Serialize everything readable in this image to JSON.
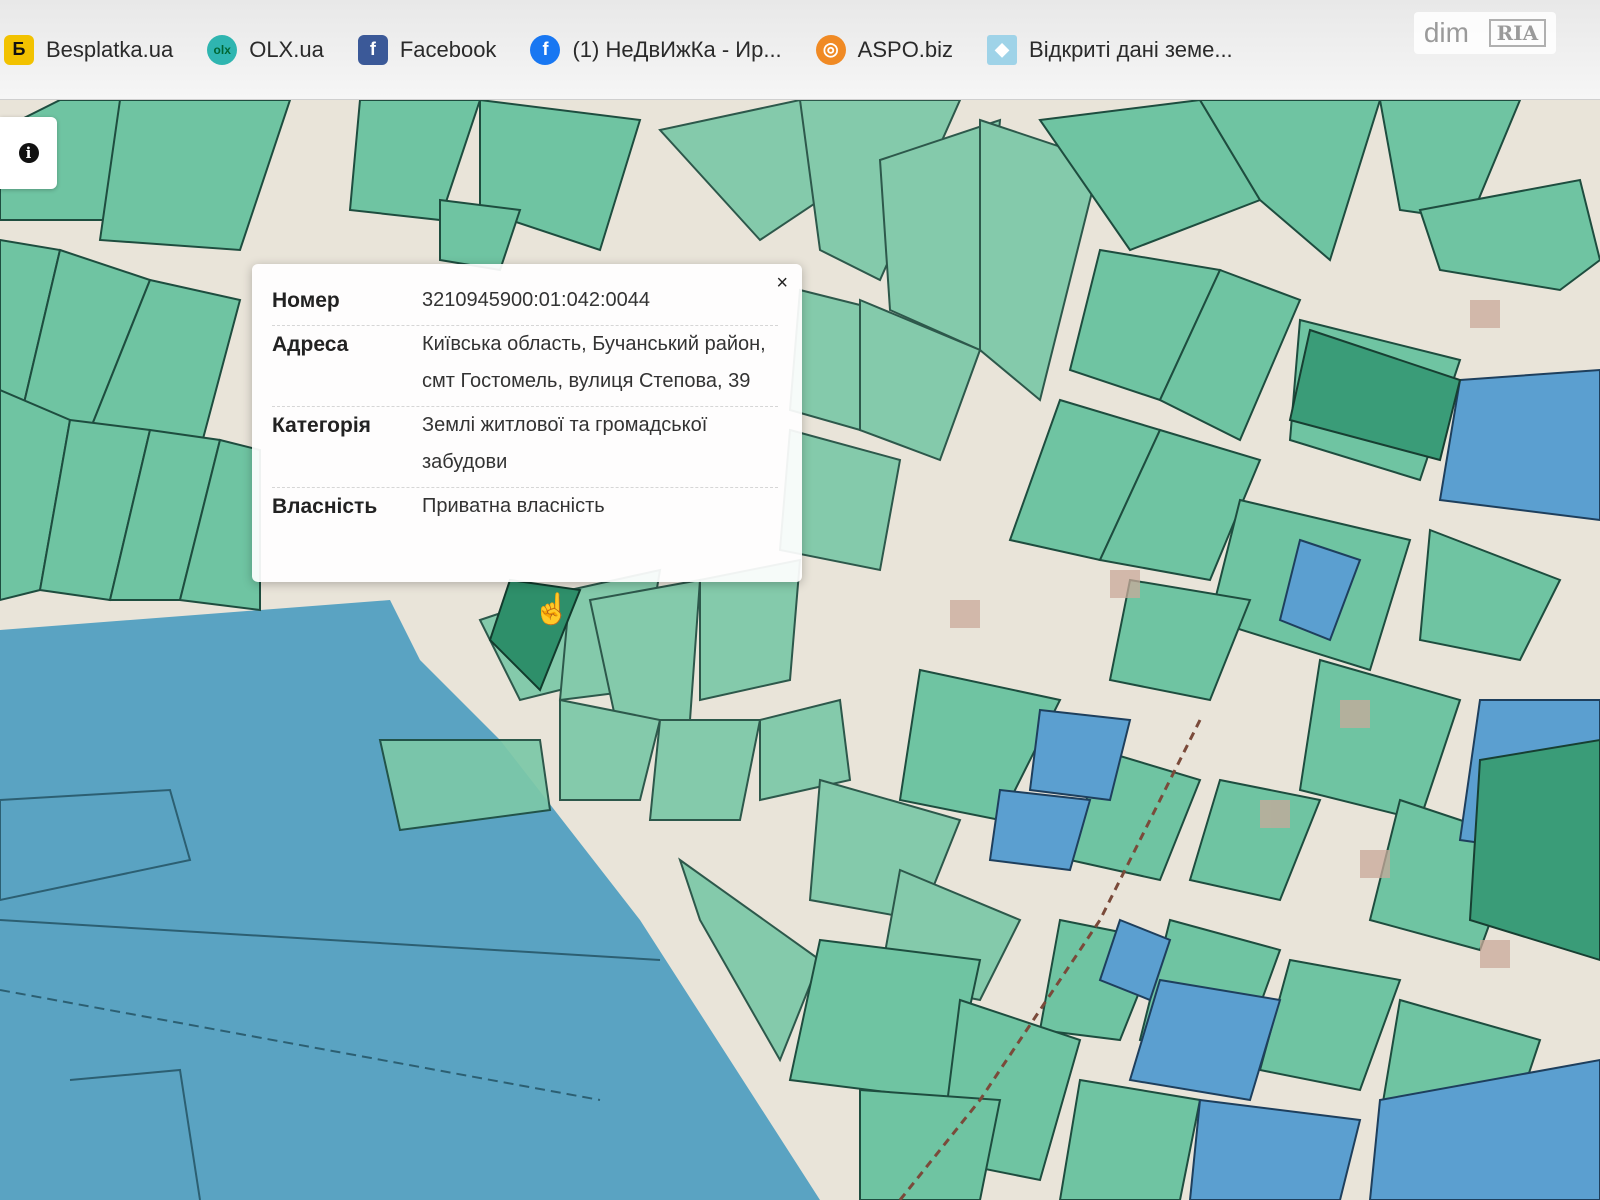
{
  "bookmarks": [
    {
      "label": "Besplatka.ua",
      "icon": "besplatka-icon",
      "glyph": "Б"
    },
    {
      "label": "OLX.ua",
      "icon": "olx-icon",
      "glyph": "olx"
    },
    {
      "label": "Facebook",
      "icon": "facebook-icon",
      "glyph": "f"
    },
    {
      "label": "(1) НеДвИжКа - Ир...",
      "icon": "facebook-round-icon",
      "glyph": "f"
    },
    {
      "label": "ASPO.biz",
      "icon": "aspo-icon",
      "glyph": "◎"
    },
    {
      "label": "Відкриті дані земе...",
      "icon": "open-data-icon",
      "glyph": "◆"
    }
  ],
  "info_button": {
    "glyph": "i",
    "icon": "info-icon"
  },
  "popup": {
    "close": "×",
    "rows": [
      {
        "label": "Номер",
        "value": "3210945900:01:042:0044"
      },
      {
        "label": "Адреса",
        "value": "Київська область, Бучанський район, смт Гостомель, вулиця Степова, 39"
      },
      {
        "label": "Категорія",
        "value": "Землі житлової та громадської забудови"
      },
      {
        "label": "Власність",
        "value": "Приватна власність"
      }
    ]
  },
  "watermark": {
    "dim": "dim",
    "ria": "RIA"
  },
  "colors": {
    "parcel_green": "#6fc4a2",
    "parcel_dark": "#3a9c78",
    "parcel_blue": "#5b9fd0",
    "water": "#5aa3c2",
    "road": "#e9e4d9",
    "selected": "#2e8f6a"
  }
}
